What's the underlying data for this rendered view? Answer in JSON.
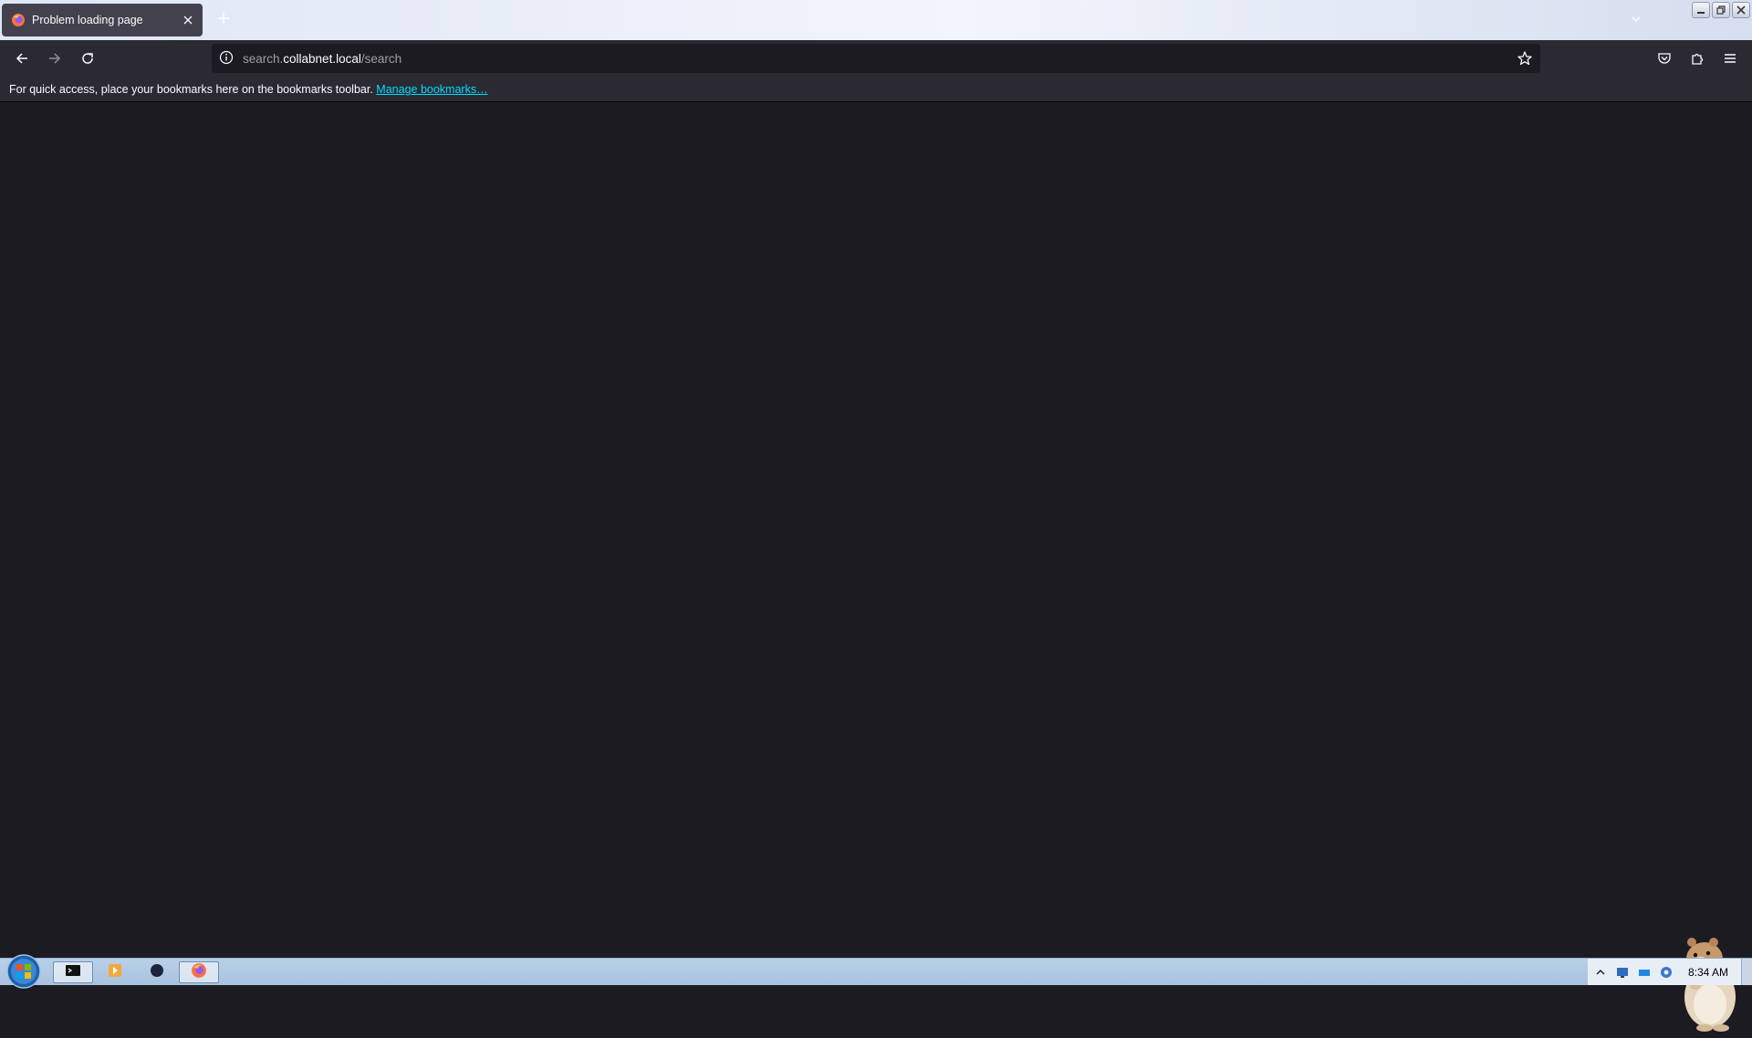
{
  "tab": {
    "title": "Problem loading page"
  },
  "navigation": {
    "url_subdomain": "search.",
    "url_domain": "collabnet.local",
    "url_path": "/search"
  },
  "bookmarks_bar": {
    "message": "For quick access, place your bookmarks here on the bookmarks toolbar.",
    "manage_link": "Manage bookmarks…"
  },
  "taskbar": {
    "clock": "8:34 AM"
  },
  "colors": {
    "page_background": "#1c1b22",
    "toolbar": "#2b2a33",
    "link": "#00ddff"
  }
}
